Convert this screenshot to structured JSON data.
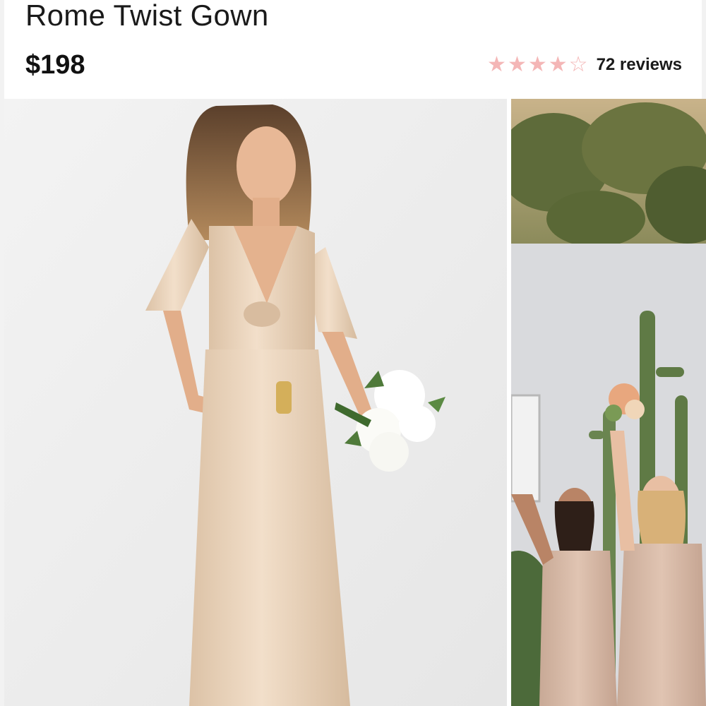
{
  "product": {
    "title": "Rome Twist Gown",
    "price": "$198",
    "rating": 4,
    "rating_max": 5,
    "reviews_label": "72 reviews"
  },
  "icons": {
    "star_full": "star-filled-icon",
    "star_empty": "star-outline-icon"
  },
  "colors": {
    "star": "#f4b6b6",
    "gown": "#e9d3ba",
    "background_studio": "#ececec"
  }
}
